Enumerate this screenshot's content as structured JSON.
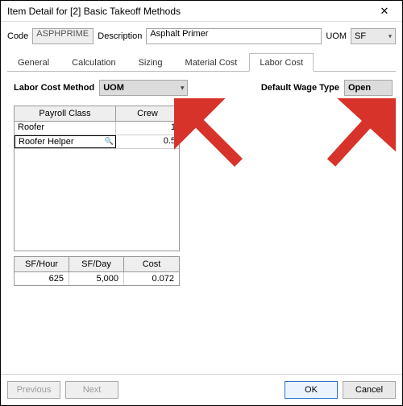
{
  "window": {
    "title": "Item Detail for [2] Basic Takeoff Methods"
  },
  "top": {
    "code_label": "Code",
    "code_value": "ASPHPRIME",
    "desc_label": "Description",
    "desc_value": "Asphalt Primer",
    "uom_label": "UOM",
    "uom_value": "SF"
  },
  "tabs": {
    "general": "General",
    "calculation": "Calculation",
    "sizing": "Sizing",
    "material": "Material Cost",
    "labor": "Labor Cost"
  },
  "labor": {
    "method_label": "Labor Cost Method",
    "method_value": "UOM",
    "wage_label": "Default Wage Type",
    "wage_value": "Open"
  },
  "grid": {
    "headers": {
      "payroll_class": "Payroll Class",
      "crew": "Crew"
    },
    "rows": [
      {
        "class": "Roofer",
        "crew": "1"
      },
      {
        "class": "Roofer Helper",
        "crew": "0.5"
      }
    ]
  },
  "summary": {
    "headers": {
      "sf_hour": "SF/Hour",
      "sf_day": "SF/Day",
      "cost": "Cost"
    },
    "values": {
      "sf_hour": "625",
      "sf_day": "5,000",
      "cost": "0.072"
    }
  },
  "buttons": {
    "previous": "Previous",
    "next": "Next",
    "ok": "OK",
    "cancel": "Cancel"
  }
}
